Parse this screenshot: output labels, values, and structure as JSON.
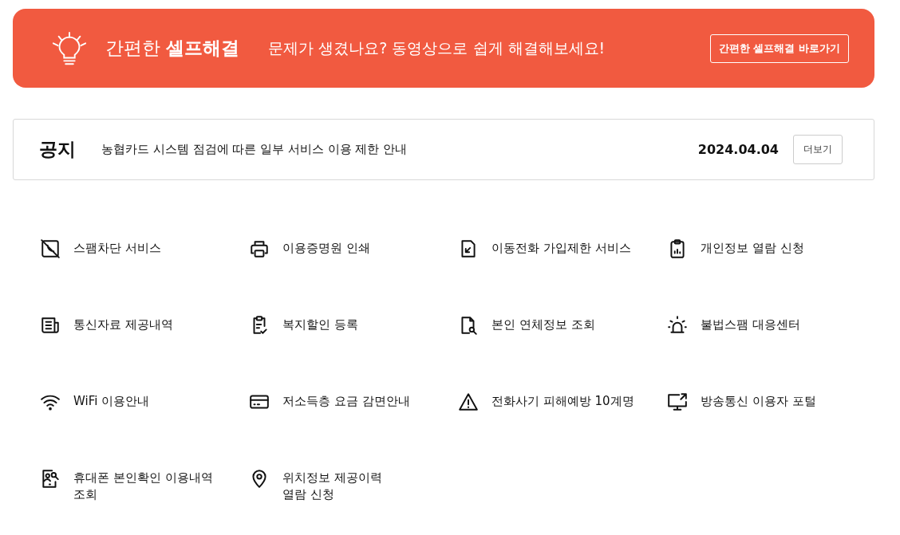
{
  "banner": {
    "title": "간편한 **셀프해결**",
    "message": "문제가 생겼나요? 동영상으로 쉽게 해결해보세요!",
    "button": "간편한 셀프해결 바로가기"
  },
  "notice": {
    "label": "공지",
    "text": "농협카드 시스템 점검에 따른 일부 서비스 이용 제한 안내",
    "date": "2024.04.04",
    "more": "더보기"
  },
  "services": [
    {
      "label": "스팸차단 서비스"
    },
    {
      "label": "이용증명원 인쇄"
    },
    {
      "label": "이동전화 가입제한 서비스"
    },
    {
      "label": "개인정보 열람 신청"
    },
    {
      "label": "통신자료 제공내역"
    },
    {
      "label": "복지할인 등록"
    },
    {
      "label": "본인 연체정보 조회"
    },
    {
      "label": "불법스팸 대응센터"
    },
    {
      "label": "WiFi 이용안내"
    },
    {
      "label": "저소득층 요금 감면안내"
    },
    {
      "label": "전화사기 피해예방 10계명"
    },
    {
      "label": "방송통신 이용자 포털"
    },
    {
      "label": "휴대폰 본인확인 이용내역\n조회"
    },
    {
      "label": "위치정보 제공이력\n열람 신청"
    }
  ]
}
